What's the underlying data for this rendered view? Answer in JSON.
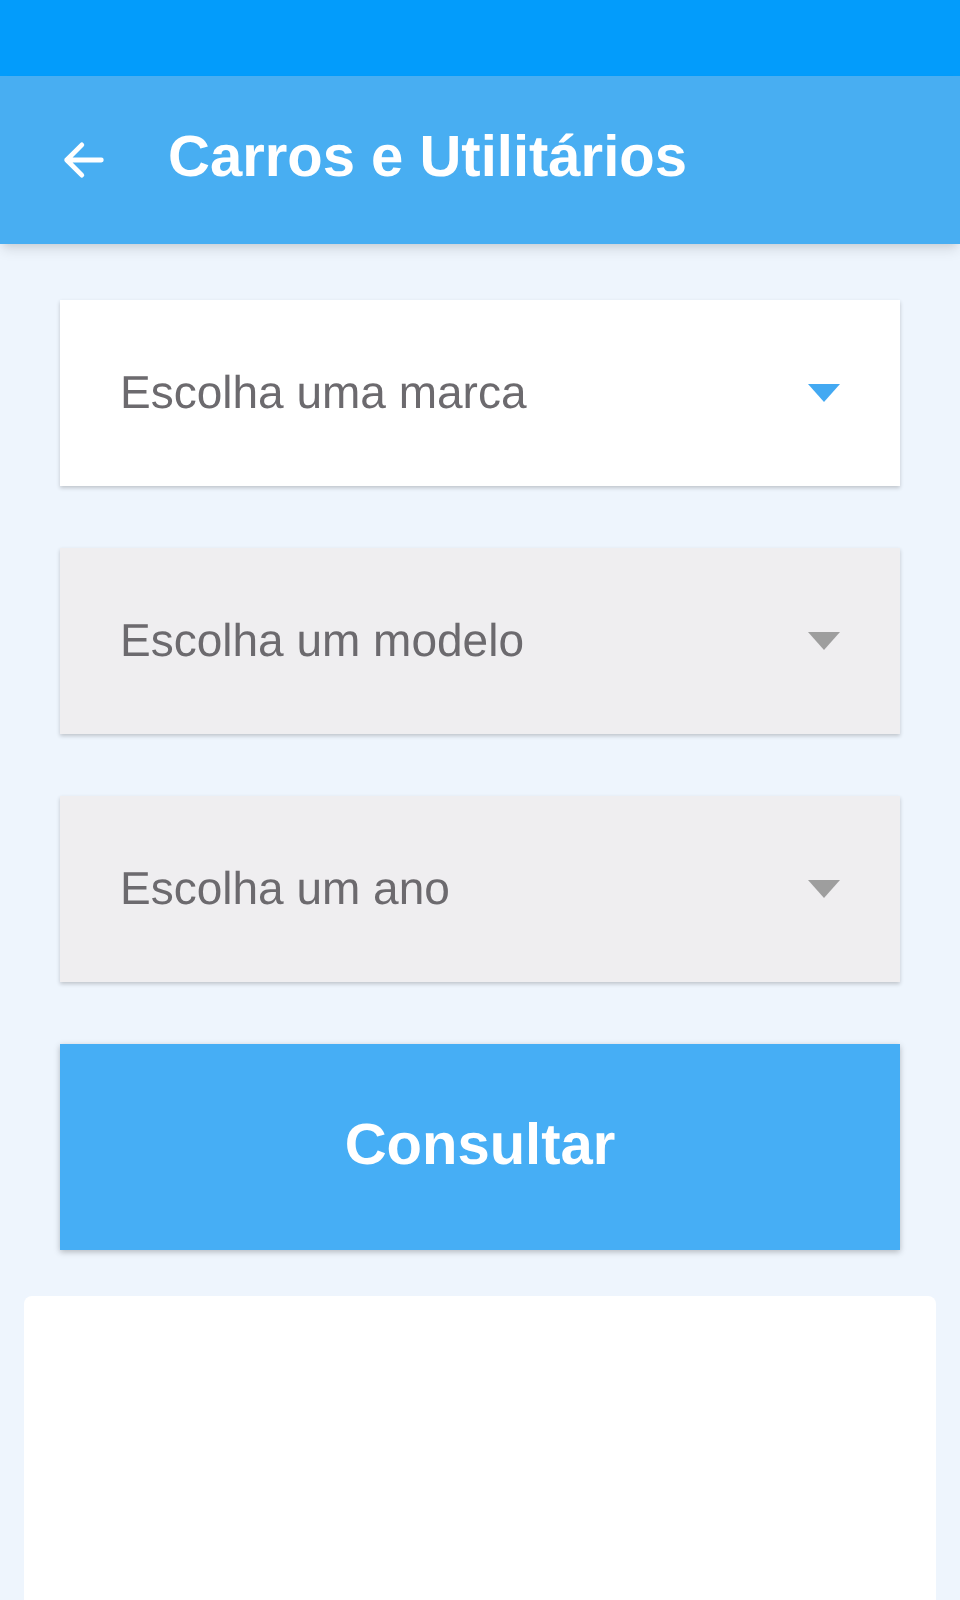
{
  "app_bar": {
    "title": "Carros e Utilitários"
  },
  "selects": [
    {
      "placeholder": "Escolha uma marca",
      "disabled": false
    },
    {
      "placeholder": "Escolha um modelo",
      "disabled": true
    },
    {
      "placeholder": "Escolha um ano",
      "disabled": true
    }
  ],
  "submit_button": {
    "label": "Consultar"
  }
}
